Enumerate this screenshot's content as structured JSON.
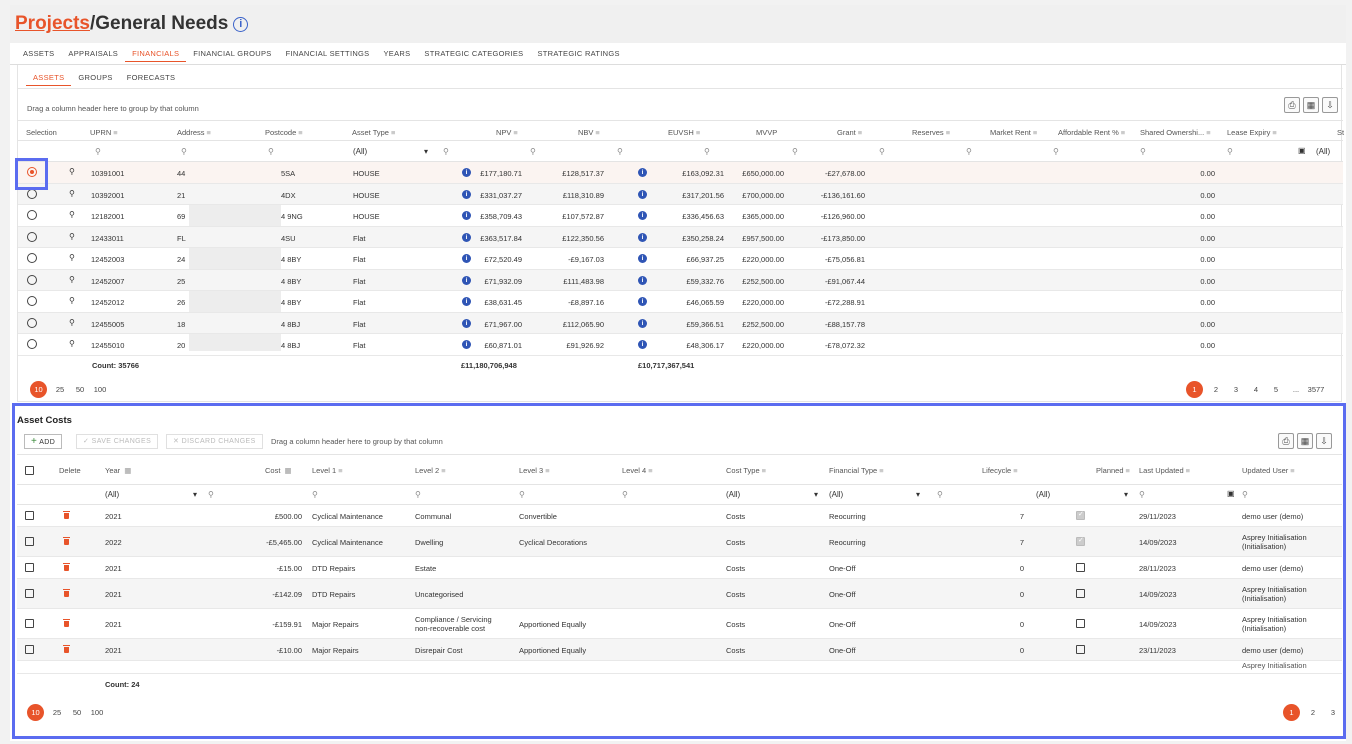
{
  "header": {
    "projects_link": "Projects",
    "title_rest": "/General Needs",
    "info_icon": "i"
  },
  "tabs_main": [
    "ASSETS",
    "APPRAISALS",
    "FINANCIALS",
    "FINANCIAL GROUPS",
    "FINANCIAL SETTINGS",
    "YEARS",
    "STRATEGIC CATEGORIES",
    "STRATEGIC RATINGS"
  ],
  "tabs_main_active": "FINANCIALS",
  "tabs_sub": [
    "ASSETS",
    "GROUPS",
    "FORECASTS"
  ],
  "tabs_sub_active": "ASSETS",
  "assets_grid": {
    "drag_hint": "Drag a column header here to group by that column",
    "columns": {
      "selection": "Selection",
      "uprn": "UPRN",
      "address": "Address",
      "postcode": "Postcode",
      "asset_type": "Asset Type",
      "npv": "NPV",
      "nbv": "NBV",
      "euvsh": "EUVSH",
      "mvvp": "MVVP",
      "grant": "Grant",
      "reserves": "Reserves",
      "market_rent": "Market Rent",
      "affordable_rent": "Affordable Rent %",
      "shared_ownership": "Shared Ownershi...",
      "lease_expiry": "Lease Expiry",
      "st": "St"
    },
    "filter_all": "(All)",
    "rows": [
      {
        "uprn": "10391001",
        "address": "44",
        "postcode": "5SA",
        "type": "HOUSE",
        "npv": "£177,180.71",
        "nbv": "£128,517.37",
        "euvsh": "£163,092.31",
        "mvvp": "£650,000.00",
        "grant": "-£27,678.00",
        "shared": "0.00"
      },
      {
        "uprn": "10392001",
        "address": "21",
        "postcode": "4DX",
        "type": "HOUSE",
        "npv": "£331,037.27",
        "nbv": "£118,310.89",
        "euvsh": "£317,201.56",
        "mvvp": "£700,000.00",
        "grant": "-£136,161.60",
        "shared": "0.00"
      },
      {
        "uprn": "12182001",
        "address": "69",
        "postcode": "4 9NG",
        "type": "HOUSE",
        "npv": "£358,709.43",
        "nbv": "£107,572.87",
        "euvsh": "£336,456.63",
        "mvvp": "£365,000.00",
        "grant": "-£126,960.00",
        "shared": "0.00"
      },
      {
        "uprn": "12433011",
        "address": "FL",
        "postcode": "4SU",
        "type": "Flat",
        "npv": "£363,517.84",
        "nbv": "£122,350.56",
        "euvsh": "£350,258.24",
        "mvvp": "£957,500.00",
        "grant": "-£173,850.00",
        "shared": "0.00"
      },
      {
        "uprn": "12452003",
        "address": "24",
        "postcode": "4 8BY",
        "type": "Flat",
        "npv": "£72,520.49",
        "nbv": "-£9,167.03",
        "euvsh": "£66,937.25",
        "mvvp": "£220,000.00",
        "grant": "-£75,056.81",
        "shared": "0.00"
      },
      {
        "uprn": "12452007",
        "address": "25",
        "postcode": "4 8BY",
        "type": "Flat",
        "npv": "£71,932.09",
        "nbv": "£111,483.98",
        "euvsh": "£59,332.76",
        "mvvp": "£252,500.00",
        "grant": "-£91,067.44",
        "shared": "0.00"
      },
      {
        "uprn": "12452012",
        "address": "26",
        "postcode": "4 8BY",
        "type": "Flat",
        "npv": "£38,631.45",
        "nbv": "-£8,897.16",
        "euvsh": "£46,065.59",
        "mvvp": "£220,000.00",
        "grant": "-£72,288.91",
        "shared": "0.00"
      },
      {
        "uprn": "12455005",
        "address": "18",
        "postcode": "4 8BJ",
        "type": "Flat",
        "npv": "£71,967.00",
        "nbv": "£112,065.90",
        "euvsh": "£59,366.51",
        "mvvp": "£252,500.00",
        "grant": "-£88,157.78",
        "shared": "0.00"
      },
      {
        "uprn": "12455010",
        "address": "20",
        "postcode": "4 8BJ",
        "type": "Flat",
        "npv": "£60,871.01",
        "nbv": "£91,926.92",
        "euvsh": "£48,306.17",
        "mvvp": "£220,000.00",
        "grant": "-£78,072.32",
        "shared": "0.00"
      }
    ],
    "footer": {
      "count": "Count: 35766",
      "npv_total": "£11,180,706,948",
      "euvsh_total": "£10,717,367,541"
    },
    "page_sizes": [
      "10",
      "25",
      "50",
      "100"
    ],
    "page_size_active": "10",
    "pages": [
      "1",
      "2",
      "3",
      "4",
      "5",
      "...",
      "3577"
    ],
    "page_active": "1"
  },
  "costs_grid": {
    "title": "Asset Costs",
    "add": "ADD",
    "save": "SAVE CHANGES",
    "discard": "DISCARD CHANGES",
    "drag_hint": "Drag a column header here to group by that column",
    "columns": {
      "delete": "Delete",
      "year": "Year",
      "cost": "Cost",
      "level1": "Level 1",
      "level2": "Level 2",
      "level3": "Level 3",
      "level4": "Level 4",
      "cost_type": "Cost Type",
      "financial_type": "Financial Type",
      "lifecycle": "Lifecycle",
      "planned": "Planned",
      "last_updated": "Last Updated",
      "updated_user": "Updated User"
    },
    "filter_all": "(All)",
    "rows": [
      {
        "year": "2021",
        "cost": "£500.00",
        "l1": "Cyclical Maintenance",
        "l2": "Communal",
        "l3": "Convertible",
        "ct": "Costs",
        "ft": "Reocurring",
        "lc": "7",
        "planned": true,
        "lu": "29/11/2023",
        "user": "demo user (demo)",
        "user2": ""
      },
      {
        "year": "2022",
        "cost": "-£5,465.00",
        "l1": "Cyclical Maintenance",
        "l2": "Dwelling",
        "l3": "Cyclical Decorations",
        "ct": "Costs",
        "ft": "Reocurring",
        "lc": "7",
        "planned": true,
        "lu": "14/09/2023",
        "user": "Asprey Initialisation",
        "user2": "(Initialisation)"
      },
      {
        "year": "2021",
        "cost": "-£15.00",
        "l1": "DTD Repairs",
        "l2": "Estate",
        "l3": "",
        "ct": "Costs",
        "ft": "One-Off",
        "lc": "0",
        "planned": false,
        "lu": "28/11/2023",
        "user": "demo user (demo)",
        "user2": ""
      },
      {
        "year": "2021",
        "cost": "-£142.09",
        "l1": "DTD Repairs",
        "l2": "Uncategorised",
        "l3": "",
        "ct": "Costs",
        "ft": "One-Off",
        "lc": "0",
        "planned": false,
        "lu": "14/09/2023",
        "user": "Asprey Initialisation",
        "user2": "(Initialisation)"
      },
      {
        "year": "2021",
        "cost": "-£159.91",
        "l1": "Major Repairs",
        "l2": "Compliance / Servicing",
        "l2b": "non-recoverable cost",
        "l3": "Apportioned Equally",
        "ct": "Costs",
        "ft": "One-Off",
        "lc": "0",
        "planned": false,
        "lu": "14/09/2023",
        "user": "Asprey Initialisation",
        "user2": "(Initialisation)"
      },
      {
        "year": "2021",
        "cost": "-£10.00",
        "l1": "Major Repairs",
        "l2": "Disrepair Cost",
        "l3": "Apportioned Equally",
        "ct": "Costs",
        "ft": "One-Off",
        "lc": "0",
        "planned": false,
        "lu": "23/11/2023",
        "user": "demo user (demo)",
        "user2": ""
      }
    ],
    "partial_row_user": "Asprey Initialisation",
    "footer": {
      "count": "Count: 24"
    },
    "page_sizes": [
      "10",
      "25",
      "50",
      "100"
    ],
    "page_size_active": "10",
    "pages": [
      "1",
      "2",
      "3"
    ],
    "page_active": "1"
  },
  "colors": {
    "accent": "#e8542a",
    "highlight": "#5b6cf0",
    "info": "#2f55b5"
  }
}
